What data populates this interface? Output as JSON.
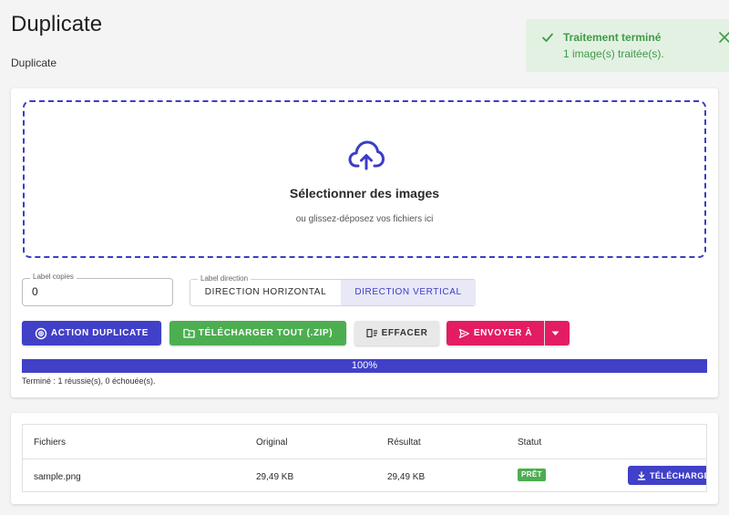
{
  "header": {
    "title": "Duplicate",
    "subtitle": "Duplicate"
  },
  "toast": {
    "title": "Traitement terminé",
    "message": "1 image(s) traitée(s).",
    "color": "#3f9a48"
  },
  "dropzone": {
    "title": "Sélectionner des images",
    "subtitle": "ou glissez-déposez vos fichiers ici",
    "icon": "cloud-upload-icon"
  },
  "copies_field": {
    "label": "Label copies",
    "value": "0"
  },
  "direction": {
    "label": "Label direction",
    "options": [
      "DIRECTION HORIZONTAL",
      "DIRECTION VERTICAL"
    ],
    "selected": "DIRECTION VERTICAL"
  },
  "actions": {
    "duplicate_label": "ACTION DUPLICATE",
    "zip_label": "TÉLÉCHARGER TOUT (.ZIP)",
    "clear_label": "EFFACER",
    "send_label": "ENVOYER À"
  },
  "progress": {
    "percent": 100,
    "text": "100%",
    "status": "Terminé : 1 réussie(s), 0 échouée(s)."
  },
  "table": {
    "headers": [
      "Fichiers",
      "Original",
      "Résultat",
      "Statut"
    ],
    "rows": [
      {
        "file": "sample.png",
        "original": "29,49 KB",
        "result": "29,49 KB",
        "status": "PRÊT",
        "download_label": "TÉLÉCHARGER"
      }
    ]
  },
  "colors": {
    "primary": "#4040c8",
    "success": "#4cae50",
    "accent": "#e31c63"
  }
}
